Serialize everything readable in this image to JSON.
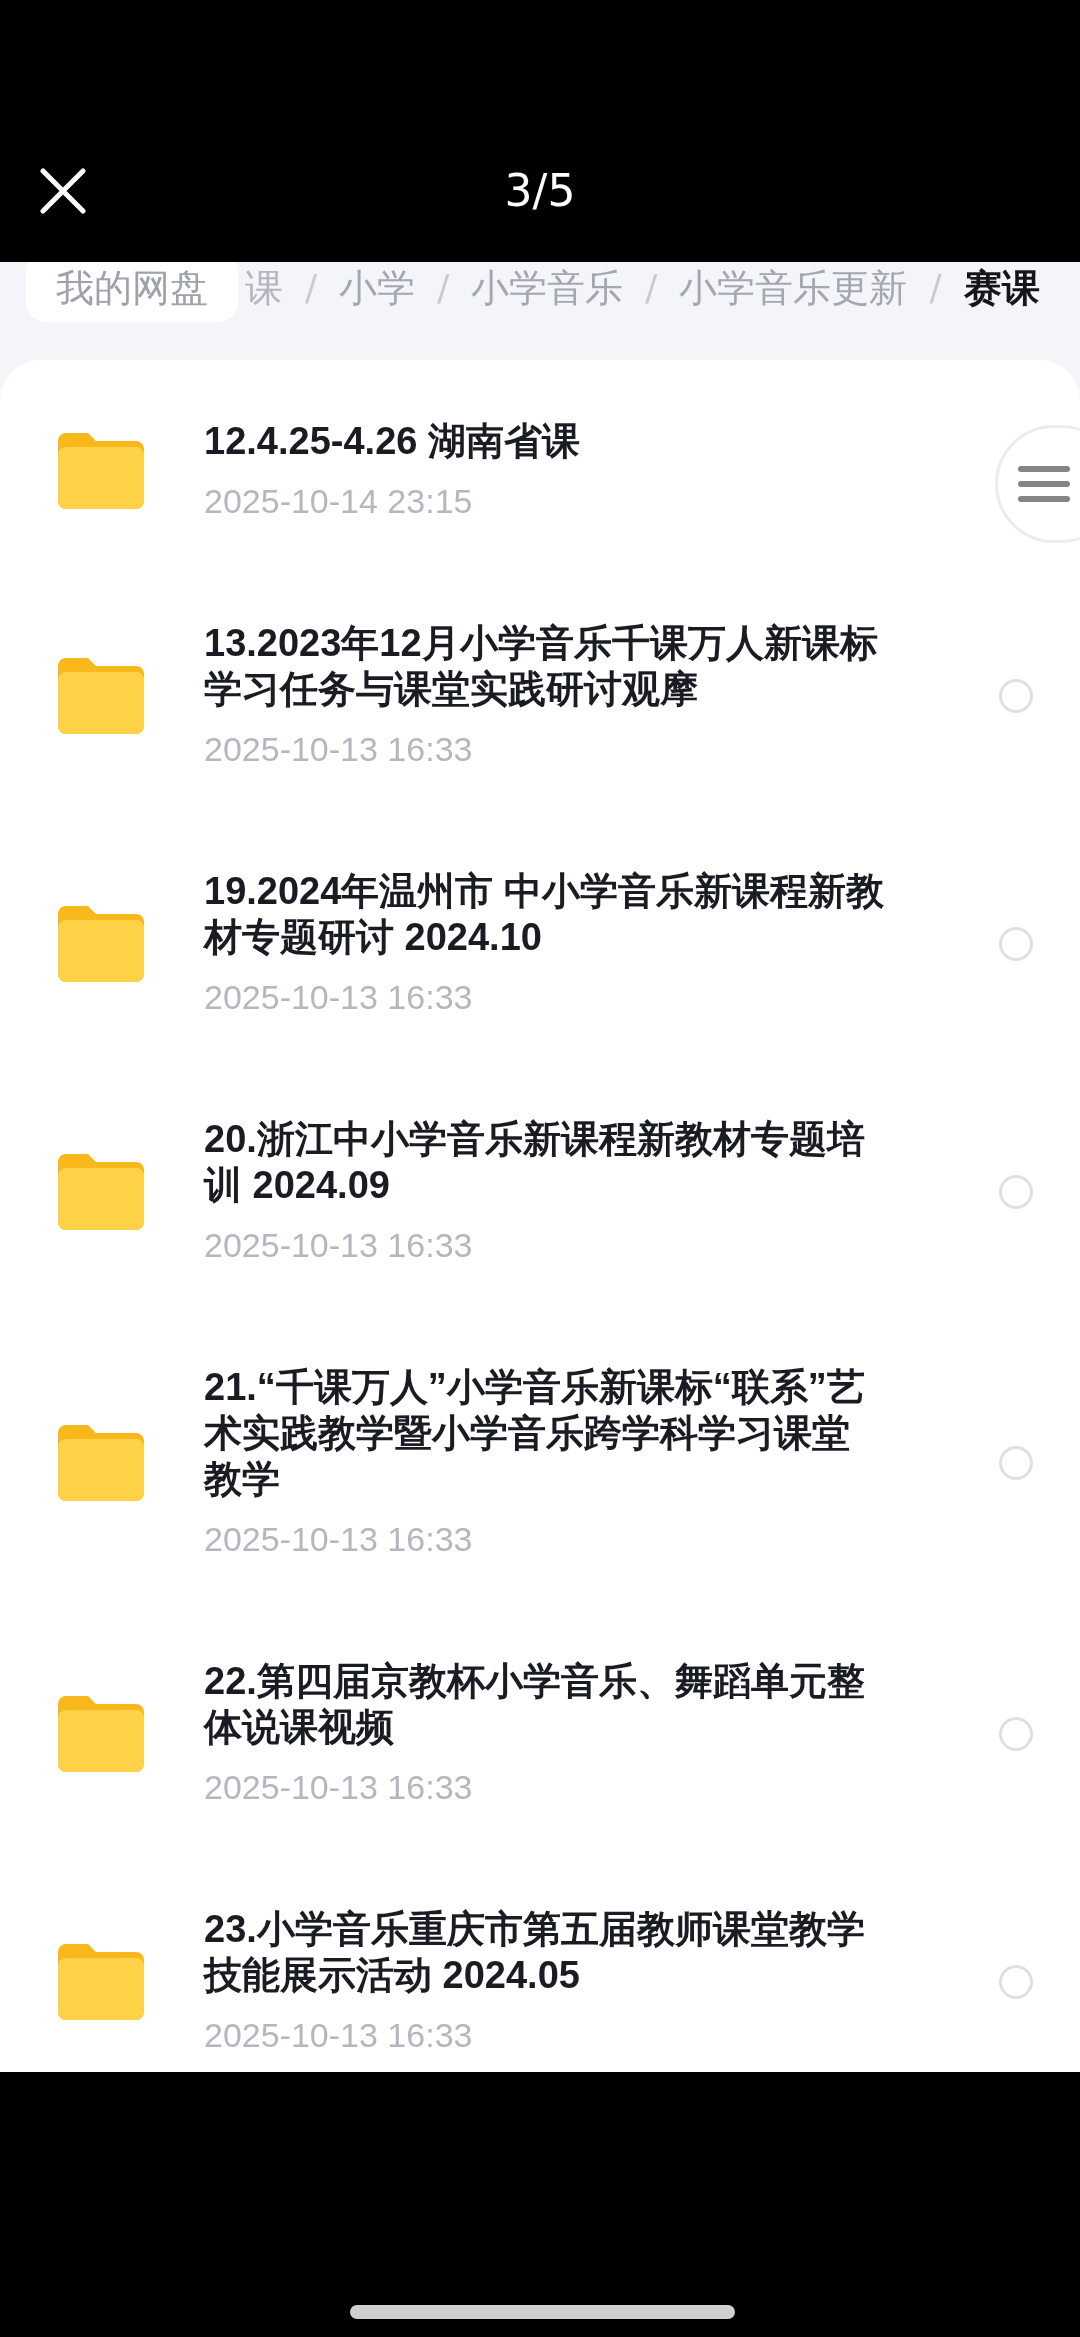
{
  "viewer": {
    "counter": "3/5"
  },
  "breadcrumb": {
    "root": "我的网盘",
    "items": [
      {
        "label": "课",
        "separator": "/",
        "selected": false
      },
      {
        "label": "小学",
        "separator": "/",
        "selected": false
      },
      {
        "label": "小学音乐",
        "separator": "/",
        "selected": false
      },
      {
        "label": "小学音乐更新",
        "separator": "/",
        "selected": false
      },
      {
        "label": "赛课",
        "selected": true
      }
    ]
  },
  "files": [
    {
      "name": "12.4.25-4.26 湖南省课",
      "date": "2025-10-14 23:15"
    },
    {
      "name": "13.2023年12月小学音乐千课万人新课标学习任务与课堂实践研讨观摩",
      "date": "2025-10-13 16:33",
      "selected": false
    },
    {
      "name": "19.2024年温州市 中小学音乐新课程新教材专题研讨 2024.10",
      "date": "2025-10-13 16:33",
      "selected": false
    },
    {
      "name": "20.浙江中小学音乐新课程新教材专题培训 2024.09",
      "date": "2025-10-13 16:33",
      "selected": false
    },
    {
      "name": "21.“千课万人”小学音乐新课标“联系”艺术实践教学暨小学音乐跨学科学习课堂教学",
      "date": "2025-10-13 16:33",
      "selected": false
    },
    {
      "name": "22.第四届京教杯小学音乐、舞蹈单元整体说课视频",
      "date": "2025-10-13 16:33",
      "selected": false
    },
    {
      "name": "23.小学音乐重庆市第五届教师课堂教学技能展示活动 2024.05",
      "date": "2025-10-13 16:33",
      "selected": false
    }
  ]
}
